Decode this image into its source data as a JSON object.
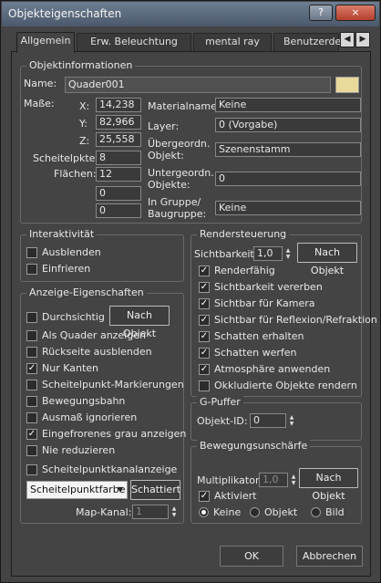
{
  "window": {
    "title": "Objekteigenschaften",
    "help_glyph": "?",
    "close_glyph": "×"
  },
  "tabs": [
    {
      "label": "Allgemein",
      "active": true
    },
    {
      "label": "Erw. Beleuchtung"
    },
    {
      "label": "mental ray"
    },
    {
      "label": "Benutzerde"
    }
  ],
  "tab_arrows": {
    "left": "◀",
    "right": "▶"
  },
  "object_info": {
    "legend": "Objektinformationen",
    "name_label": "Name:",
    "name_value": "Quader001",
    "color_swatch": "#e9d99a",
    "dims_label": "Maße:",
    "x_label": "X:",
    "x_value": "14,238",
    "y_label": "Y:",
    "y_value": "82,966",
    "z_label": "Z:",
    "z_value": "25,558",
    "vertices_label": "Scheitelpkte:",
    "vertices_value": "8",
    "faces_label": "Flächen:",
    "faces_value": "12",
    "extra1_value": "0",
    "extra2_value": "0",
    "material_label": "Materialname:",
    "material_value": "Keine",
    "layer_label": "Layer:",
    "layer_value": "0 (Vorgabe)",
    "parent_label_1": "Übergeordn.",
    "parent_label_2": "Objekt:",
    "parent_value": "Szenenstamm",
    "children_label_1": "Untergeordn.",
    "children_label_2": "Objekte:",
    "children_value": "0",
    "group_label_1": "In Gruppe/",
    "group_label_2": "Baugruppe:",
    "group_value": "Keine"
  },
  "interactivity": {
    "legend": "Interaktivität",
    "hide_label": "Ausblenden",
    "hide_checked": false,
    "freeze_label": "Einfrieren",
    "freeze_checked": false
  },
  "display": {
    "legend": "Anzeige-Eigenschaften",
    "by_object_label": "Nach Objekt",
    "items": [
      {
        "label": "Durchsichtig",
        "checked": false
      },
      {
        "label": "Als Quader anzeigen",
        "checked": false
      },
      {
        "label": "Rückseite ausblenden",
        "checked": false
      },
      {
        "label": "Nur Kanten",
        "checked": true
      },
      {
        "label": "Scheitelpunkt-Markierungen",
        "checked": false
      },
      {
        "label": "Bewegungsbahn",
        "checked": false
      },
      {
        "label": "Ausmaß ignorieren",
        "checked": false
      },
      {
        "label": "Eingefrorenes grau anzeigen",
        "checked": true
      },
      {
        "label": "Nie reduzieren",
        "checked": false
      },
      {
        "label": "Scheitelpunktkanalanzeige",
        "checked": false
      }
    ],
    "channel_select": "Scheitelpunktfarbe",
    "shaded_label": "Schattiert",
    "map_channel_label": "Map-Kanal:",
    "map_channel_value": "1"
  },
  "render": {
    "legend": "Rendersteuerung",
    "visibility_label": "Sichtbarkeit:",
    "visibility_value": "1,0",
    "by_object_label": "Nach Objekt",
    "items": [
      {
        "label": "Renderfähig",
        "checked": true
      },
      {
        "label": "Sichtbarkeit vererben",
        "checked": true
      },
      {
        "label": "Sichtbar für Kamera",
        "checked": true
      },
      {
        "label": "Sichtbar für Reflexion/Refraktion",
        "checked": true
      },
      {
        "label": "Schatten erhalten",
        "checked": true
      },
      {
        "label": "Schatten werfen",
        "checked": true
      },
      {
        "label": "Atmosphäre anwenden",
        "checked": true
      },
      {
        "label": "Okkludierte Objekte rendern",
        "checked": false
      }
    ]
  },
  "gbuffer": {
    "legend": "G-Puffer",
    "object_id_label": "Objekt-ID:",
    "object_id_value": "0"
  },
  "motion_blur": {
    "legend": "Bewegungsunschärfe",
    "multiplier_label": "Multiplikator:",
    "multiplier_value": "1,0",
    "by_object_label": "Nach Objekt",
    "enabled_label": "Aktiviert",
    "enabled_checked": true,
    "radios": [
      {
        "label": "Keine",
        "selected": true
      },
      {
        "label": "Objekt",
        "selected": false
      },
      {
        "label": "Bild",
        "selected": false
      }
    ]
  },
  "footer": {
    "ok_label": "OK",
    "cancel_label": "Abbrechen"
  }
}
